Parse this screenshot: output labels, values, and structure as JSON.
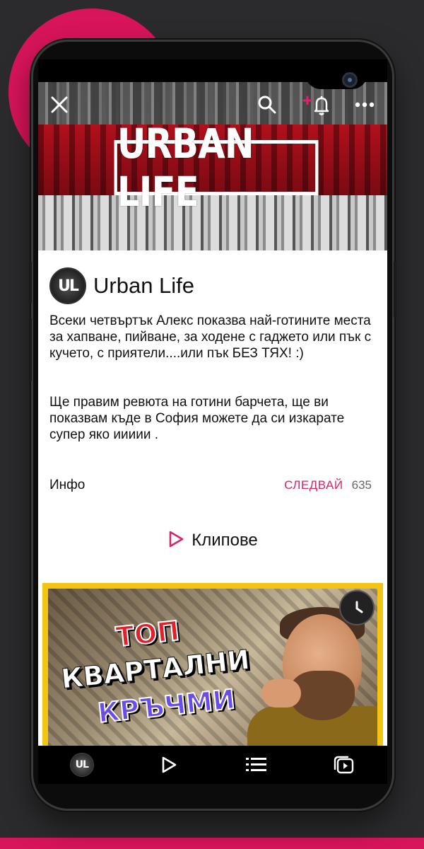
{
  "banner": {
    "logo_text": "URBAN LIFE"
  },
  "channel": {
    "avatar_text": "UL",
    "name": "Urban Life",
    "description": [
      "Всеки четвъртък Алекс показва най-готините места за хапване, пийване, за ходене с гаджето или пък с кучето, с приятели....или пък БЕЗ ТЯХ! :)",
      "Ще правим ревюта на готини барчета, ще ви показвам къде в София можете да си изкарате супер яко иииии ."
    ],
    "info_label": "Инфо",
    "follow_label": "СЛЕДВАЙ",
    "follower_count": "635"
  },
  "clips": {
    "label": "Клипове"
  },
  "video": {
    "thumb_lines": [
      "ТОП",
      "КВАРТАЛНИ",
      "КРЪЧМИ"
    ]
  },
  "nav": {
    "avatar_text": "UL"
  },
  "colors": {
    "accent": "#d4266a",
    "brand_pink": "#d8145a",
    "thumb_border": "#f3c412"
  },
  "icons": {
    "top_bar": [
      "close-icon",
      "search-icon",
      "add-notification-icon",
      "more-icon"
    ],
    "bottom_nav": [
      "channel-avatar-icon",
      "play-icon",
      "list-icon",
      "playlists-icon"
    ]
  }
}
